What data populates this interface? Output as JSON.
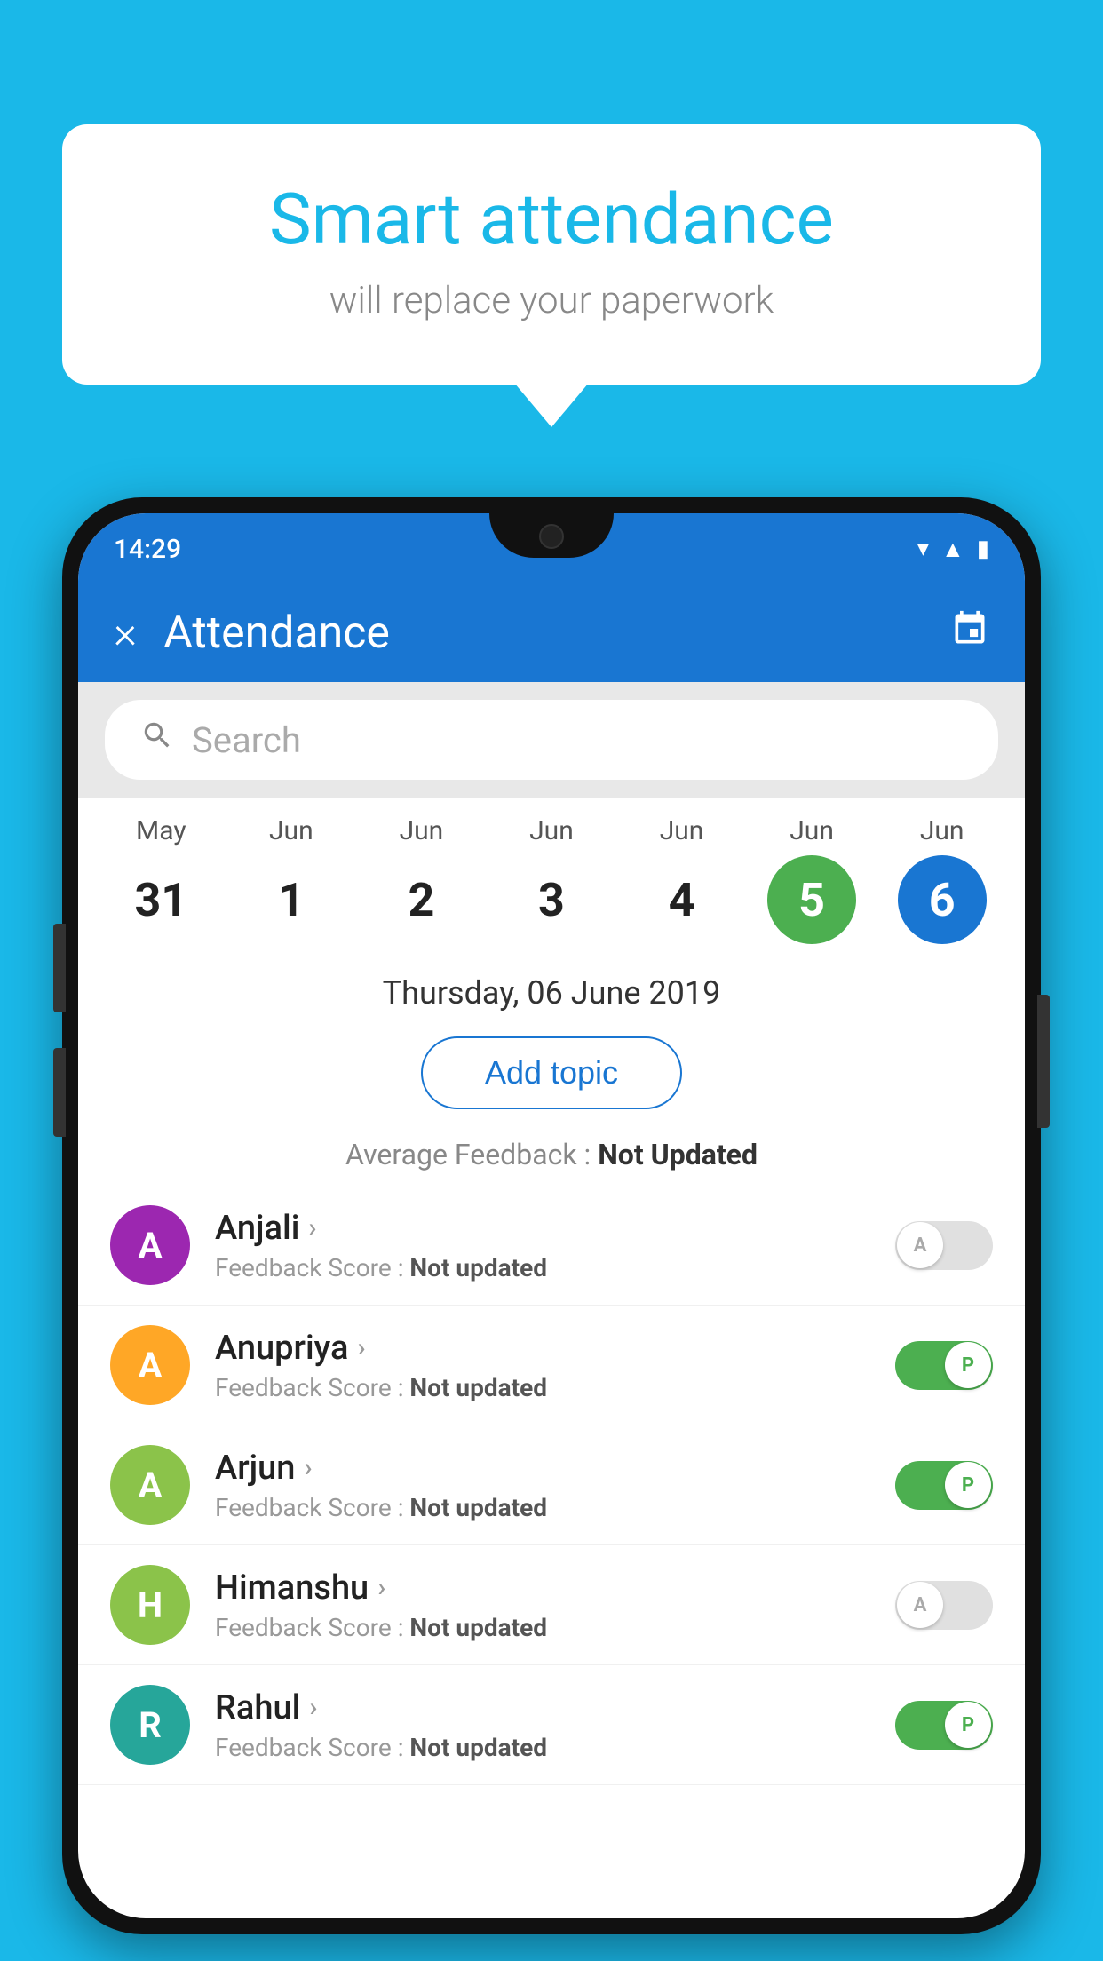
{
  "background_color": "#1ab8e8",
  "speech_bubble": {
    "title": "Smart attendance",
    "subtitle": "will replace your paperwork"
  },
  "status_bar": {
    "time": "14:29",
    "icons": [
      "wifi",
      "signal",
      "battery"
    ]
  },
  "header": {
    "title": "Attendance",
    "close_label": "×",
    "calendar_icon": "📅"
  },
  "search": {
    "placeholder": "Search"
  },
  "calendar": {
    "days": [
      {
        "month": "May",
        "day": "31",
        "state": "normal"
      },
      {
        "month": "Jun",
        "day": "1",
        "state": "normal"
      },
      {
        "month": "Jun",
        "day": "2",
        "state": "normal"
      },
      {
        "month": "Jun",
        "day": "3",
        "state": "normal"
      },
      {
        "month": "Jun",
        "day": "4",
        "state": "normal"
      },
      {
        "month": "Jun",
        "day": "5",
        "state": "today"
      },
      {
        "month": "Jun",
        "day": "6",
        "state": "selected"
      }
    ]
  },
  "selected_date": "Thursday, 06 June 2019",
  "add_topic_label": "Add topic",
  "avg_feedback_label": "Average Feedback :",
  "avg_feedback_value": "Not Updated",
  "students": [
    {
      "name": "Anjali",
      "initial": "A",
      "avatar_color": "#9c27b0",
      "feedback_label": "Feedback Score :",
      "feedback_value": "Not updated",
      "toggle_state": "off",
      "toggle_label": "A"
    },
    {
      "name": "Anupriya",
      "initial": "A",
      "avatar_color": "#ffa726",
      "feedback_label": "Feedback Score :",
      "feedback_value": "Not updated",
      "toggle_state": "on",
      "toggle_label": "P"
    },
    {
      "name": "Arjun",
      "initial": "A",
      "avatar_color": "#8bc34a",
      "feedback_label": "Feedback Score :",
      "feedback_value": "Not updated",
      "toggle_state": "on",
      "toggle_label": "P"
    },
    {
      "name": "Himanshu",
      "initial": "H",
      "avatar_color": "#8bc34a",
      "feedback_label": "Feedback Score :",
      "feedback_value": "Not updated",
      "toggle_state": "off",
      "toggle_label": "A"
    },
    {
      "name": "Rahul",
      "initial": "R",
      "avatar_color": "#26a69a",
      "feedback_label": "Feedback Score :",
      "feedback_value": "Not updated",
      "toggle_state": "on",
      "toggle_label": "P"
    }
  ]
}
